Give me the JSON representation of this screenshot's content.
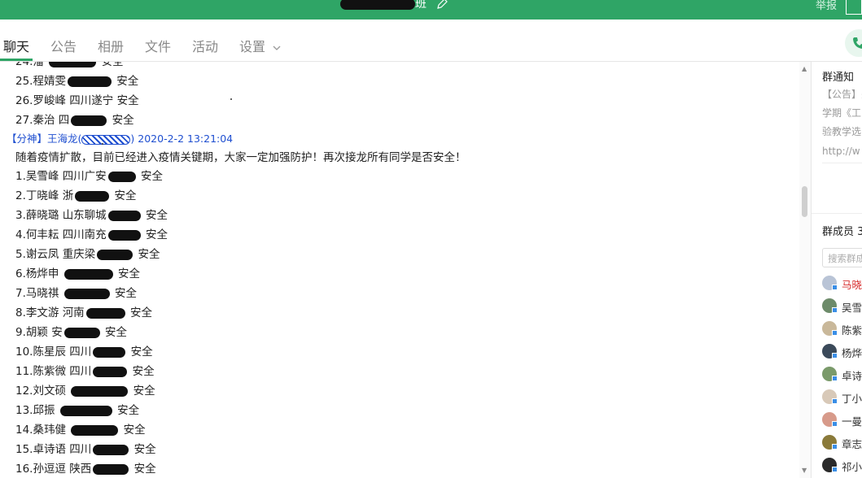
{
  "window": {
    "title_suffix": "班",
    "report_label": "举报"
  },
  "tabs": [
    {
      "label": "聊天"
    },
    {
      "label": "公告"
    },
    {
      "label": "相册"
    },
    {
      "label": "文件"
    },
    {
      "label": "活动"
    },
    {
      "label": "设置"
    }
  ],
  "chat": {
    "top_lines": [
      {
        "num": "24.",
        "name": "潘",
        "tail": "安全"
      },
      {
        "num": "25.",
        "name": "程婧雯",
        "tail": "安全"
      },
      {
        "num": "26.",
        "name": "罗峻峰",
        "place": "四川遂宁",
        "tail": "安全"
      },
      {
        "num": "27.",
        "name": "秦治",
        "place": "四",
        "tail": "安全"
      }
    ],
    "message": {
      "tag": "【分神】",
      "sender": "王海龙(",
      "sender_end": ")",
      "timestamp": "2020-2-2 13:21:04",
      "intro": "随着疫情扩散，目前已经进入疫情关键期，大家一定加强防护！再次接龙所有同学是否安全！"
    },
    "list": [
      {
        "num": "1.",
        "name": "吴雪峰",
        "place": "四川广安",
        "tail": "安全"
      },
      {
        "num": "2.",
        "name": "丁晓峰",
        "place": "浙",
        "tail": "安全"
      },
      {
        "num": "3.",
        "name": "薛晓璐",
        "place": "山东聊城",
        "tail": "安全"
      },
      {
        "num": "4.",
        "name": "何丰耘",
        "place": "四川南充",
        "tail": "安全"
      },
      {
        "num": "5.",
        "name": "谢云凤",
        "place": "重庆梁",
        "tail": "安全"
      },
      {
        "num": "6.",
        "name": "杨烨申",
        "place": "",
        "tail": "安全"
      },
      {
        "num": "7.",
        "name": "马晓祺",
        "place": "",
        "tail": "安全"
      },
      {
        "num": "8.",
        "name": "李文游",
        "place": "河南",
        "tail": "安全"
      },
      {
        "num": "9.",
        "name": "胡颖",
        "place": "安",
        "tail": "安全"
      },
      {
        "num": "10.",
        "name": "陈星辰",
        "place": "四川",
        "tail": "安全"
      },
      {
        "num": "11.",
        "name": "陈紫微",
        "place": "四川",
        "tail": "安全"
      },
      {
        "num": "12.",
        "name": "刘文硕",
        "place": "",
        "tail": "安全"
      },
      {
        "num": "13.",
        "name": "邱振",
        "place": "",
        "tail": "安全"
      },
      {
        "num": "14.",
        "name": "桑玮健",
        "place": "",
        "tail": "安全"
      },
      {
        "num": "15.",
        "name": "卓诗语",
        "place": "四川",
        "tail": "安全"
      },
      {
        "num": "16.",
        "name": "孙逗逗",
        "place": "陕西",
        "tail": "安全"
      }
    ]
  },
  "sidebar": {
    "notice_title": "群通知",
    "notice_lines": [
      "【公告】关",
      "学期《工",
      "验教学选",
      "http://w"
    ],
    "members_title": "群成员 3",
    "search_placeholder": "搜索群成",
    "members": [
      {
        "name": "马晓",
        "highlight": true,
        "avatar_color": "#b9c4d6"
      },
      {
        "name": "吴雪",
        "highlight": false,
        "avatar_color": "#6d8b6a"
      },
      {
        "name": "陈紫",
        "highlight": false,
        "avatar_color": "#c9b89a"
      },
      {
        "name": "杨烨",
        "highlight": false,
        "avatar_color": "#3b4a5a"
      },
      {
        "name": "卓诗",
        "highlight": false,
        "avatar_color": "#7a9a6a"
      },
      {
        "name": "丁小",
        "highlight": false,
        "avatar_color": "#d8c9b8"
      },
      {
        "name": "一曼",
        "highlight": false,
        "avatar_color": "#d79a8a"
      },
      {
        "name": "章志",
        "highlight": false,
        "avatar_color": "#8a7a3a"
      },
      {
        "name": "祁小",
        "highlight": false,
        "avatar_color": "#2a2a2a"
      }
    ]
  },
  "colors": {
    "brand_green": "#2fa566",
    "link_blue": "#1f4fd0",
    "highlight_red": "#d62b2b"
  }
}
